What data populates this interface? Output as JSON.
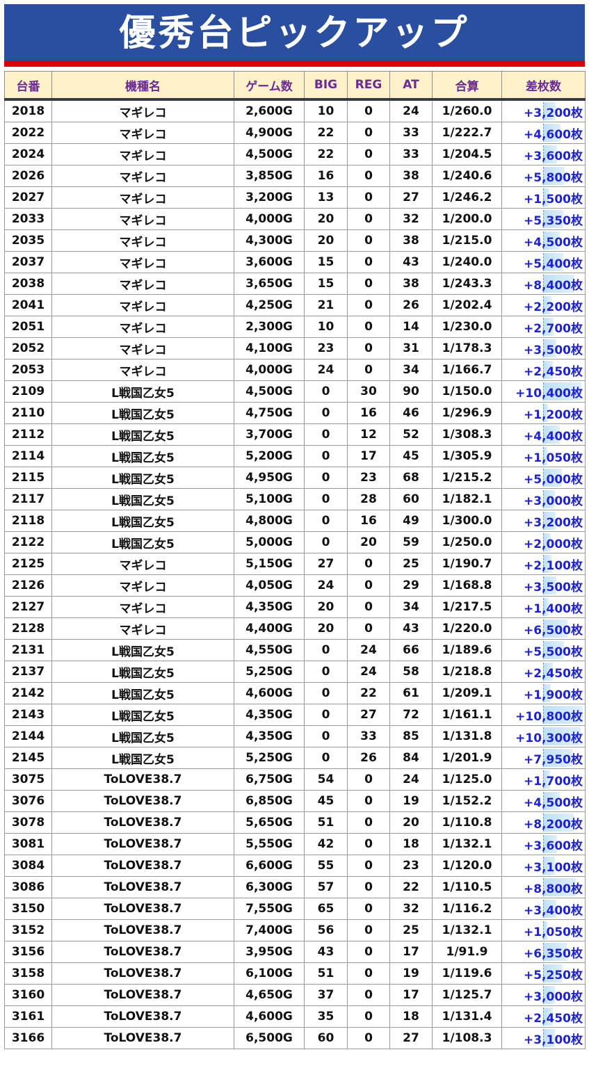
{
  "banner": {
    "title": "優秀台ピックアップ",
    "bg": "#2a4ea0",
    "stripe": "#dc0000"
  },
  "colors": {
    "header_bg": "#fff1c8",
    "header_text": "#6a2a9a",
    "diff_text": "#1e22d6",
    "bar": "#bfe0f5"
  },
  "table": {
    "headers": [
      "台番",
      "機種名",
      "ゲーム数",
      "BIG",
      "REG",
      "AT",
      "合算",
      "差枚数"
    ],
    "rows": [
      [
        "2018",
        "マギレコ",
        "2,600G",
        "10",
        "0",
        "24",
        "1/260.0",
        "+3,200枚"
      ],
      [
        "2022",
        "マギレコ",
        "4,900G",
        "22",
        "0",
        "33",
        "1/222.7",
        "+4,600枚"
      ],
      [
        "2024",
        "マギレコ",
        "4,500G",
        "22",
        "0",
        "33",
        "1/204.5",
        "+3,600枚"
      ],
      [
        "2026",
        "マギレコ",
        "3,850G",
        "16",
        "0",
        "38",
        "1/240.6",
        "+5,800枚"
      ],
      [
        "2027",
        "マギレコ",
        "3,200G",
        "13",
        "0",
        "27",
        "1/246.2",
        "+1,500枚"
      ],
      [
        "2033",
        "マギレコ",
        "4,000G",
        "20",
        "0",
        "32",
        "1/200.0",
        "+5,350枚"
      ],
      [
        "2035",
        "マギレコ",
        "4,300G",
        "20",
        "0",
        "38",
        "1/215.0",
        "+4,500枚"
      ],
      [
        "2037",
        "マギレコ",
        "3,600G",
        "15",
        "0",
        "43",
        "1/240.0",
        "+5,400枚"
      ],
      [
        "2038",
        "マギレコ",
        "3,650G",
        "15",
        "0",
        "38",
        "1/243.3",
        "+8,400枚"
      ],
      [
        "2041",
        "マギレコ",
        "4,250G",
        "21",
        "0",
        "26",
        "1/202.4",
        "+2,200枚"
      ],
      [
        "2051",
        "マギレコ",
        "2,300G",
        "10",
        "0",
        "14",
        "1/230.0",
        "+2,700枚"
      ],
      [
        "2052",
        "マギレコ",
        "4,100G",
        "23",
        "0",
        "31",
        "1/178.3",
        "+3,500枚"
      ],
      [
        "2053",
        "マギレコ",
        "4,000G",
        "24",
        "0",
        "34",
        "1/166.7",
        "+2,450枚"
      ],
      [
        "2109",
        "L戦国乙女5",
        "4,500G",
        "0",
        "30",
        "90",
        "1/150.0",
        "+10,400枚"
      ],
      [
        "2110",
        "L戦国乙女5",
        "4,750G",
        "0",
        "16",
        "46",
        "1/296.9",
        "+1,200枚"
      ],
      [
        "2112",
        "L戦国乙女5",
        "3,700G",
        "0",
        "12",
        "52",
        "1/308.3",
        "+4,400枚"
      ],
      [
        "2114",
        "L戦国乙女5",
        "5,200G",
        "0",
        "17",
        "45",
        "1/305.9",
        "+1,050枚"
      ],
      [
        "2115",
        "L戦国乙女5",
        "4,950G",
        "0",
        "23",
        "68",
        "1/215.2",
        "+5,000枚"
      ],
      [
        "2117",
        "L戦国乙女5",
        "5,100G",
        "0",
        "28",
        "60",
        "1/182.1",
        "+3,000枚"
      ],
      [
        "2118",
        "L戦国乙女5",
        "4,800G",
        "0",
        "16",
        "49",
        "1/300.0",
        "+3,200枚"
      ],
      [
        "2122",
        "L戦国乙女5",
        "5,000G",
        "0",
        "20",
        "59",
        "1/250.0",
        "+2,000枚"
      ],
      [
        "2125",
        "マギレコ",
        "5,150G",
        "27",
        "0",
        "25",
        "1/190.7",
        "+2,100枚"
      ],
      [
        "2126",
        "マギレコ",
        "4,050G",
        "24",
        "0",
        "29",
        "1/168.8",
        "+3,500枚"
      ],
      [
        "2127",
        "マギレコ",
        "4,350G",
        "20",
        "0",
        "34",
        "1/217.5",
        "+1,400枚"
      ],
      [
        "2128",
        "マギレコ",
        "4,400G",
        "20",
        "0",
        "43",
        "1/220.0",
        "+6,500枚"
      ],
      [
        "2131",
        "L戦国乙女5",
        "4,550G",
        "0",
        "24",
        "66",
        "1/189.6",
        "+5,500枚"
      ],
      [
        "2137",
        "L戦国乙女5",
        "5,250G",
        "0",
        "24",
        "58",
        "1/218.8",
        "+2,450枚"
      ],
      [
        "2142",
        "L戦国乙女5",
        "4,600G",
        "0",
        "22",
        "61",
        "1/209.1",
        "+1,900枚"
      ],
      [
        "2143",
        "L戦国乙女5",
        "4,350G",
        "0",
        "27",
        "72",
        "1/161.1",
        "+10,800枚"
      ],
      [
        "2144",
        "L戦国乙女5",
        "4,350G",
        "0",
        "33",
        "85",
        "1/131.8",
        "+10,300枚"
      ],
      [
        "2145",
        "L戦国乙女5",
        "5,250G",
        "0",
        "26",
        "84",
        "1/201.9",
        "+7,950枚"
      ],
      [
        "3075",
        "ToLOVE38.7",
        "6,750G",
        "54",
        "0",
        "24",
        "1/125.0",
        "+1,700枚"
      ],
      [
        "3076",
        "ToLOVE38.7",
        "6,850G",
        "45",
        "0",
        "19",
        "1/152.2",
        "+4,500枚"
      ],
      [
        "3078",
        "ToLOVE38.7",
        "5,650G",
        "51",
        "0",
        "20",
        "1/110.8",
        "+8,200枚"
      ],
      [
        "3081",
        "ToLOVE38.7",
        "5,550G",
        "42",
        "0",
        "18",
        "1/132.1",
        "+3,600枚"
      ],
      [
        "3084",
        "ToLOVE38.7",
        "6,600G",
        "55",
        "0",
        "23",
        "1/120.0",
        "+3,100枚"
      ],
      [
        "3086",
        "ToLOVE38.7",
        "6,300G",
        "57",
        "0",
        "22",
        "1/110.5",
        "+8,800枚"
      ],
      [
        "3150",
        "ToLOVE38.7",
        "7,550G",
        "65",
        "0",
        "32",
        "1/116.2",
        "+3,400枚"
      ],
      [
        "3152",
        "ToLOVE38.7",
        "7,400G",
        "56",
        "0",
        "25",
        "1/132.1",
        "+1,050枚"
      ],
      [
        "3156",
        "ToLOVE38.7",
        "3,950G",
        "43",
        "0",
        "17",
        "1/91.9",
        "+6,350枚"
      ],
      [
        "3158",
        "ToLOVE38.7",
        "6,100G",
        "51",
        "0",
        "19",
        "1/119.6",
        "+5,250枚"
      ],
      [
        "3160",
        "ToLOVE38.7",
        "4,650G",
        "37",
        "0",
        "17",
        "1/125.7",
        "+3,000枚"
      ],
      [
        "3161",
        "ToLOVE38.7",
        "4,600G",
        "35",
        "0",
        "18",
        "1/131.4",
        "+2,450枚"
      ],
      [
        "3166",
        "ToLOVE38.7",
        "6,500G",
        "60",
        "0",
        "27",
        "1/108.3",
        "+3,100枚"
      ]
    ]
  }
}
